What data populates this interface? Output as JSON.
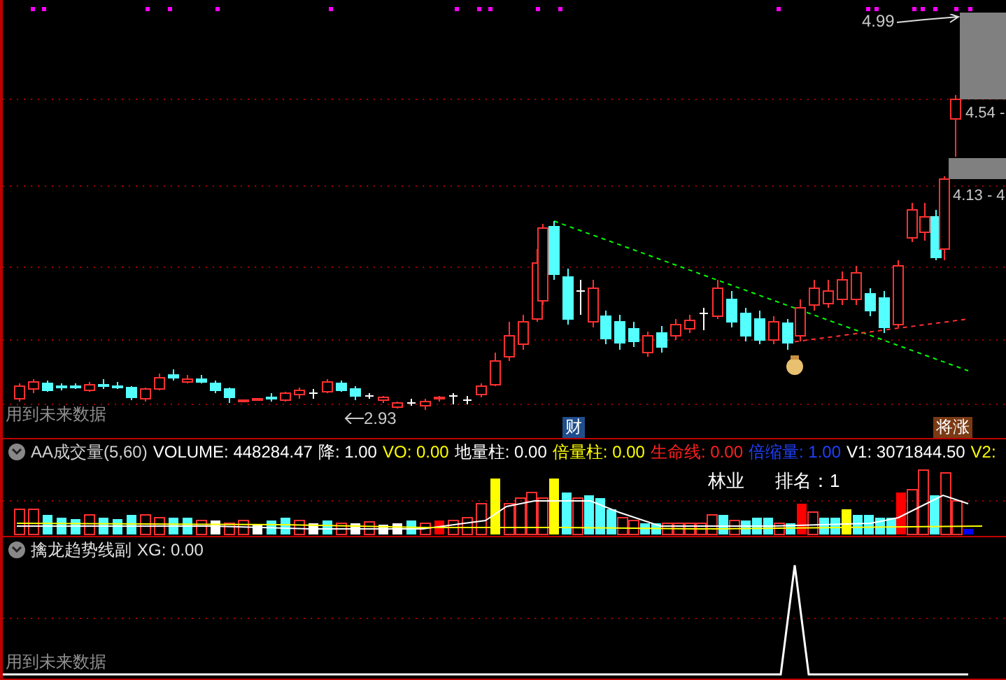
{
  "main_chart": {
    "price_labels": [
      {
        "kind": "high",
        "text": "4.99"
      },
      {
        "kind": "level",
        "text": "4.54 -"
      },
      {
        "kind": "level",
        "text": "4.13 - 4"
      }
    ],
    "low_label": "2.93",
    "note": "用到未来数据",
    "event_badges": [
      {
        "text": "财",
        "color": "#1f4e8c"
      },
      {
        "text": "将涨",
        "color": "#7a3a14"
      }
    ]
  },
  "volume_panel": {
    "title": "AA成交量(5,60)",
    "fields": [
      {
        "label": "VOLUME:",
        "value": "448284.47",
        "color": "#ffffff"
      },
      {
        "label": "降:",
        "value": "1.00",
        "color": "#ffffff"
      },
      {
        "label": "VO:",
        "value": "0.00",
        "color": "#ffff00"
      },
      {
        "label": "地量柱:",
        "value": "0.00",
        "color": "#ffffff"
      },
      {
        "label": "倍量柱:",
        "value": "0.00",
        "color": "#ffff00"
      },
      {
        "label": "生命线:",
        "value": "0.00",
        "color": "#ff2020"
      },
      {
        "label": "倍缩量:",
        "value": "1.00",
        "color": "#2040ff"
      },
      {
        "label": "V1:",
        "value": "3071844.50",
        "color": "#ffffff"
      },
      {
        "label": "V2:",
        "color": "#ffff00"
      }
    ],
    "sector": "林业",
    "rank": "排名：1"
  },
  "trend_panel": {
    "title": "擒龙趋势线副",
    "fields": [
      {
        "label": "XG:",
        "value": "0.00"
      }
    ],
    "note": "用到未来数据"
  }
}
